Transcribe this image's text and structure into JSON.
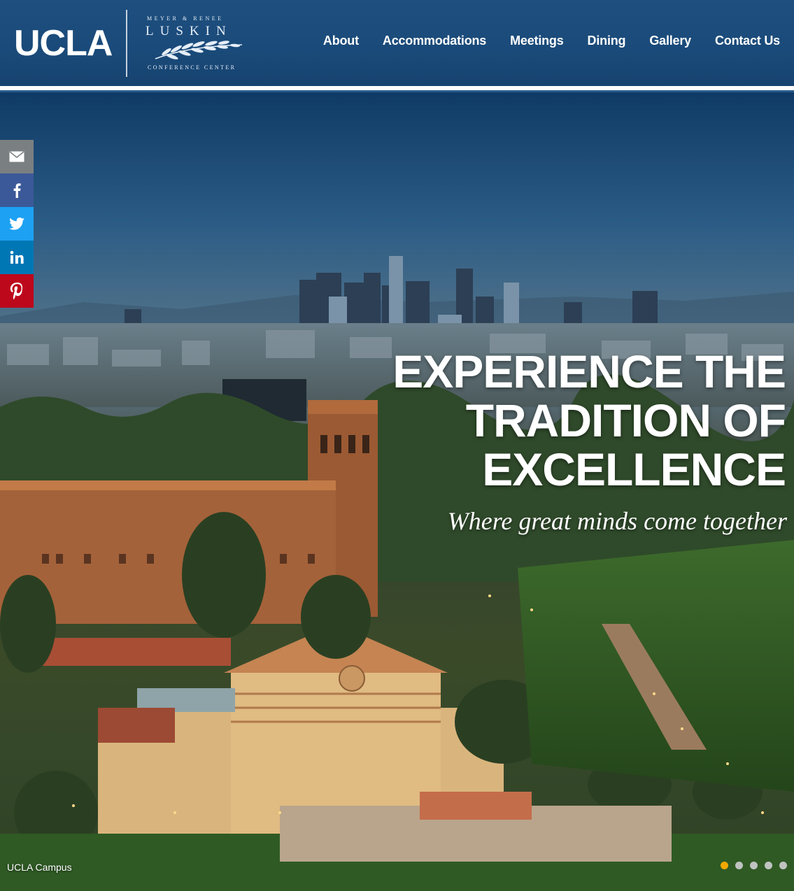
{
  "header": {
    "logo_text": "UCLA",
    "luskin_top": "MEYER & RENEE",
    "luskin_name": "LUSKIN",
    "luskin_bottom": "CONFERENCE CENTER",
    "nav": [
      {
        "label": "About"
      },
      {
        "label": "Accommodations"
      },
      {
        "label": "Meetings"
      },
      {
        "label": "Dining"
      },
      {
        "label": "Gallery"
      },
      {
        "label": "Contact Us"
      }
    ]
  },
  "share": [
    {
      "icon": "email-icon",
      "color": "#7a7f82"
    },
    {
      "icon": "facebook-icon",
      "color": "#3b5998"
    },
    {
      "icon": "twitter-icon",
      "color": "#1da1f2"
    },
    {
      "icon": "linkedin-icon",
      "color": "#0077b5"
    },
    {
      "icon": "pinterest-icon",
      "color": "#bd081c"
    }
  ],
  "hero": {
    "headline_lines": [
      "EXPERIENCE THE",
      "TRADITION OF",
      "EXCELLENCE"
    ],
    "tagline": "Where great minds come together",
    "caption": "UCLA Campus",
    "slides": 5,
    "active_slide": 1,
    "dot_active_color": "#f2a800"
  }
}
